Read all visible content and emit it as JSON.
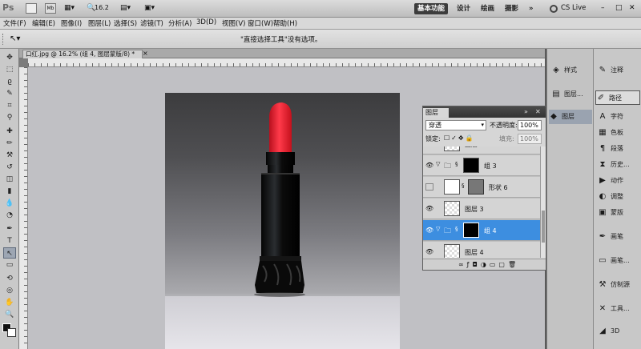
{
  "app": {
    "logo": "Ps",
    "zoom": "16.2",
    "workspaces": [
      "基本功能",
      "设计",
      "绘画",
      "摄影"
    ],
    "active_workspace": "基本功能",
    "expand": "»",
    "cslive": "CS Live"
  },
  "menu": [
    "文件(F)",
    "编辑(E)",
    "图像(I)",
    "图层(L)",
    "选择(S)",
    "滤镜(T)",
    "分析(A)",
    "3D(D)",
    "视图(V)",
    "窗口(W)",
    "帮助(H)"
  ],
  "options": {
    "hint": "\"直接选择工具\"没有选项。"
  },
  "document": {
    "tab_title": "口红.jpg @ 16.2% (组 4, 图层蒙版/8) *",
    "close": "×"
  },
  "layers_panel": {
    "title": "图层",
    "blend_mode": "穿透",
    "opacity_label": "不透明度:",
    "opacity_value": "100%",
    "lock_label": "锁定:",
    "fill_label": "填充:",
    "fill_value": "100%",
    "rows": [
      {
        "name": "图层",
        "visible": true,
        "selected": false
      },
      {
        "name": "组 3",
        "visible": true,
        "selected": false
      },
      {
        "name": "形状 6",
        "visible": false,
        "selected": false
      },
      {
        "name": "图层 3",
        "visible": true,
        "selected": false
      },
      {
        "name": "组 4",
        "visible": true,
        "selected": true
      },
      {
        "name": "图层 4",
        "visible": true,
        "selected": false
      }
    ]
  },
  "dock1": [
    "样式",
    "图层...",
    "图层"
  ],
  "dock2": [
    "注释",
    "路径",
    "字符",
    "色板",
    "段落",
    "历史...",
    "动作",
    "调整",
    "蒙版",
    "画笔",
    "画笔...",
    "仿制源",
    "工具...",
    "3D"
  ],
  "icons": {
    "eye": "eye-icon",
    "folder": "folder-icon",
    "link": "link-icon"
  }
}
